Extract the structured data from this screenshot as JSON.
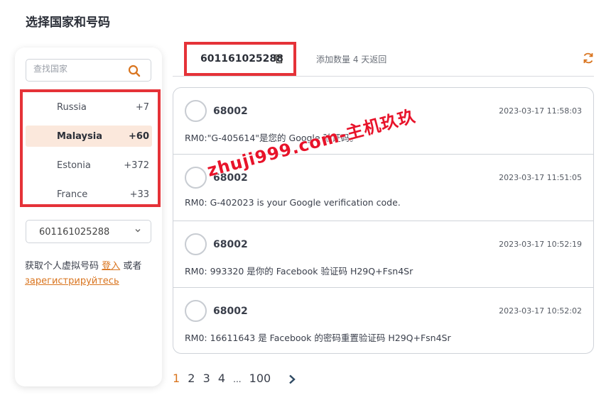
{
  "page_title": "选择国家和号码",
  "search": {
    "placeholder": "查找国家"
  },
  "countries": [
    {
      "name": "Russia",
      "code": "+7",
      "active": false
    },
    {
      "name": "Malaysia",
      "code": "+60",
      "active": true
    },
    {
      "name": "Estonia",
      "code": "+372",
      "active": false
    },
    {
      "name": "France",
      "code": "+33",
      "active": false
    }
  ],
  "number_select": {
    "value": "601161025288"
  },
  "promo": {
    "text": "获取个人虚拟号码",
    "login": "登入",
    "or": "或者",
    "register": "зарегистрируйтесь"
  },
  "topbar": {
    "number": "601161025288",
    "add_hint": "添加数量 4 天返回"
  },
  "messages": [
    {
      "sender": "68002",
      "time": "2023-03-17 11:58:03",
      "body": "RM0:\"G-405614\"是您的 Google 验证码。"
    },
    {
      "sender": "68002",
      "time": "2023-03-17 11:51:05",
      "body": "RM0: G-402023 is your Google verification code."
    },
    {
      "sender": "68002",
      "time": "2023-03-17 10:52:19",
      "body": "RM0: 993320 是你的 Facebook 验证码 H29Q+Fsn4Sr"
    },
    {
      "sender": "68002",
      "time": "2023-03-17 10:52:02",
      "body": "RM0: 16611643 是 Facebook 的密码重置验证码 H29Q+Fsn4Sr"
    }
  ],
  "pagination": {
    "pages": [
      "1",
      "2",
      "3",
      "4"
    ],
    "ellipsis": "...",
    "last": "100",
    "current": "1"
  },
  "watermark": "zhuji999.com-主机玖玖",
  "colors": {
    "accent": "#d9741e",
    "highlight": "#e53238",
    "active_bg": "#fbe8dc"
  }
}
